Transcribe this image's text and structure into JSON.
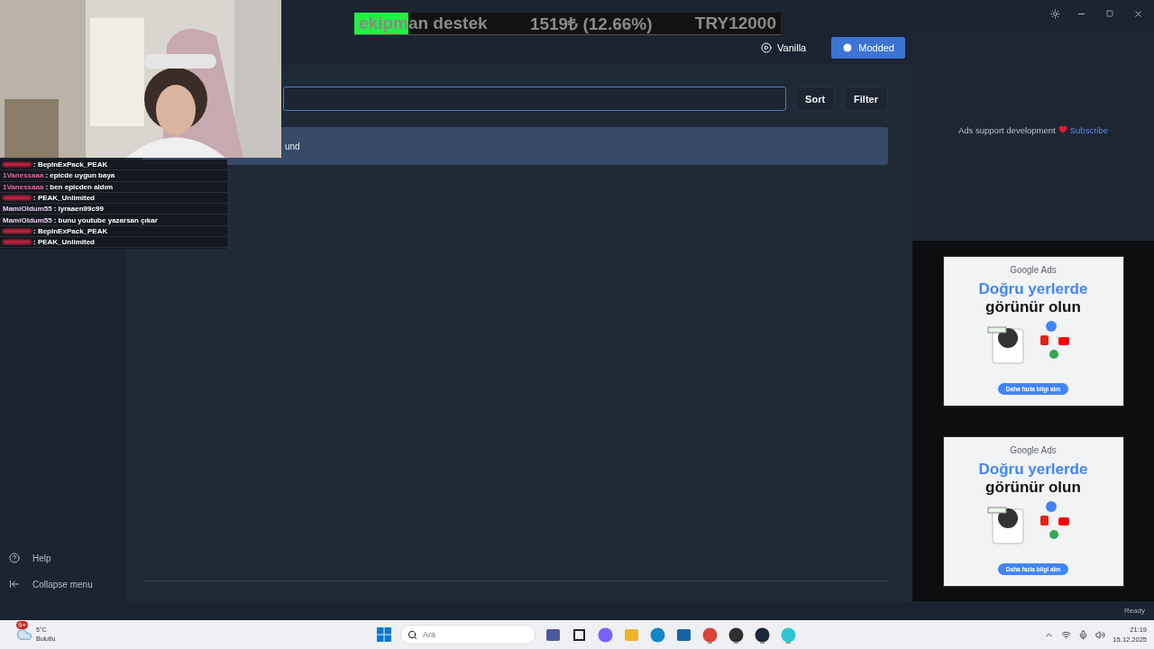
{
  "donation_goal": {
    "title": "ekipman destek",
    "amount": "1519₺ (12.66%)",
    "target": "TRY12000",
    "level": 0.1266
  },
  "chat": [
    {
      "kind": "hidden",
      "color": "#c0203f",
      "message": ": BepInExPack_PEAK"
    },
    {
      "kind": "name",
      "name": "1Vanessaaa",
      "color": "#e0689a",
      "message": ": epicde uygun baya"
    },
    {
      "kind": "name",
      "name": "1Vanessaaa",
      "color": "#e0689a",
      "message": ": ben epicden aldım"
    },
    {
      "kind": "hidden",
      "color": "#c0203f",
      "message": ": PEAK_Unlimited"
    },
    {
      "kind": "name",
      "name": "MamiOldum55",
      "color": "#e8d0f0",
      "message": ": lyraaen99c99"
    },
    {
      "kind": "name",
      "name": "MamiOldum55",
      "color": "#e8d0f0",
      "message": ": bunu youtube yazarsan çıkar"
    },
    {
      "kind": "hidden",
      "color": "#c0203f",
      "message": ": BepInExPack_PEAK"
    },
    {
      "kind": "hidden",
      "color": "#c0203f",
      "message": ": PEAK_Unlimited"
    }
  ],
  "launch": [
    {
      "label": "Vanilla",
      "selected": false
    },
    {
      "label": "Modded",
      "selected": true
    }
  ],
  "toolbar": {
    "buttons": [
      "Sort",
      "Filter"
    ]
  },
  "mod_list": {
    "message": "und"
  },
  "sidebar": {
    "bottom_items": [
      {
        "label": "Help"
      },
      {
        "label": "Collapse menu"
      }
    ]
  },
  "ads": {
    "note": "Ads support development",
    "link": "Subscribe",
    "banners": [
      {
        "brand": "Google Ads",
        "headline": "Doğru yerlerde",
        "subline": "görünür olun",
        "cta": "Daha fazla bilgi alın"
      },
      {
        "brand": "Google Ads",
        "headline": "Doğru yerlerde",
        "subline": "görünür olun",
        "cta": "Daha fazla bilgi alın"
      }
    ]
  },
  "status_bar": {
    "text": "Ready"
  },
  "taskbar": {
    "weather": {
      "temp": "5°C",
      "condition": "Bulutlu",
      "badge": "9+"
    },
    "search": {
      "placeholder": "Ara"
    },
    "apps": [
      {
        "kind": "widgets",
        "open": false
      },
      {
        "kind": "taskview",
        "open": false
      },
      {
        "kind": "copilot",
        "open": false
      },
      {
        "kind": "files",
        "open": false
      },
      {
        "kind": "edge",
        "open": false
      },
      {
        "kind": "store",
        "open": false
      },
      {
        "kind": "chrome",
        "open": true
      },
      {
        "kind": "obs",
        "open": true
      },
      {
        "kind": "steam",
        "open": true
      },
      {
        "kind": "gale",
        "open": true
      }
    ],
    "time": "21:19",
    "date": "15.12.2025"
  }
}
